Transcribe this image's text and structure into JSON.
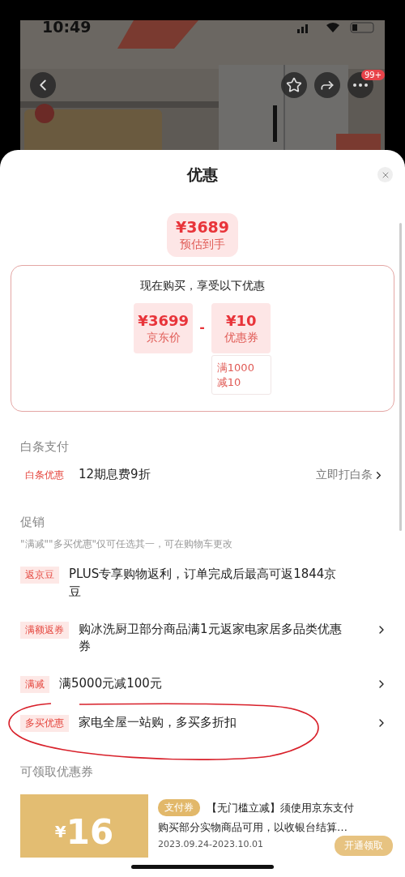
{
  "status_bar": {
    "time": "10:49"
  },
  "header": {
    "badge": "99+"
  },
  "sheet": {
    "title": "优惠",
    "estimate": {
      "price": "¥3689",
      "label": "预估到手"
    },
    "breakdown": {
      "heading": "现在购买，享受以下优惠",
      "operator": "-",
      "items": [
        {
          "price": "¥3699",
          "label": "京东价"
        },
        {
          "price": "¥10",
          "label": "优惠券",
          "note": "满1000\n减10"
        }
      ]
    },
    "baitiao": {
      "heading": "白条支付",
      "tag": "白条优惠",
      "text": "12期息费9折",
      "link": "立即打白条"
    },
    "promotions": {
      "heading": "促销",
      "note": "\"满减\"\"多买优惠\"仅可任选其一，可在购物车更改",
      "items": [
        {
          "tag": "返京豆",
          "text": "PLUS专享购物返利，订单完成后最高可返1844京豆",
          "arrow": false,
          "circled": false
        },
        {
          "tag": "满额返券",
          "text": "购冰洗厨卫部分商品满1元返家电家居多品类优惠券",
          "arrow": true,
          "circled": false
        },
        {
          "tag": "满减",
          "text": "满5000元减100元",
          "arrow": true,
          "circled": false
        },
        {
          "tag": "多买优惠",
          "text": "家电全屋一站购，多买多折扣",
          "arrow": true,
          "circled": true
        }
      ]
    },
    "coupons": {
      "heading": "可领取优惠券",
      "items": [
        {
          "currency": "¥",
          "amount": "16",
          "tag": "支付券",
          "title": "【无门槛立减】须使用京东支付",
          "desc": "购买部分实物商品可用，以收银台结算…",
          "date": "2023.09.24-2023.10.01",
          "button": "开通领取"
        }
      ]
    }
  }
}
